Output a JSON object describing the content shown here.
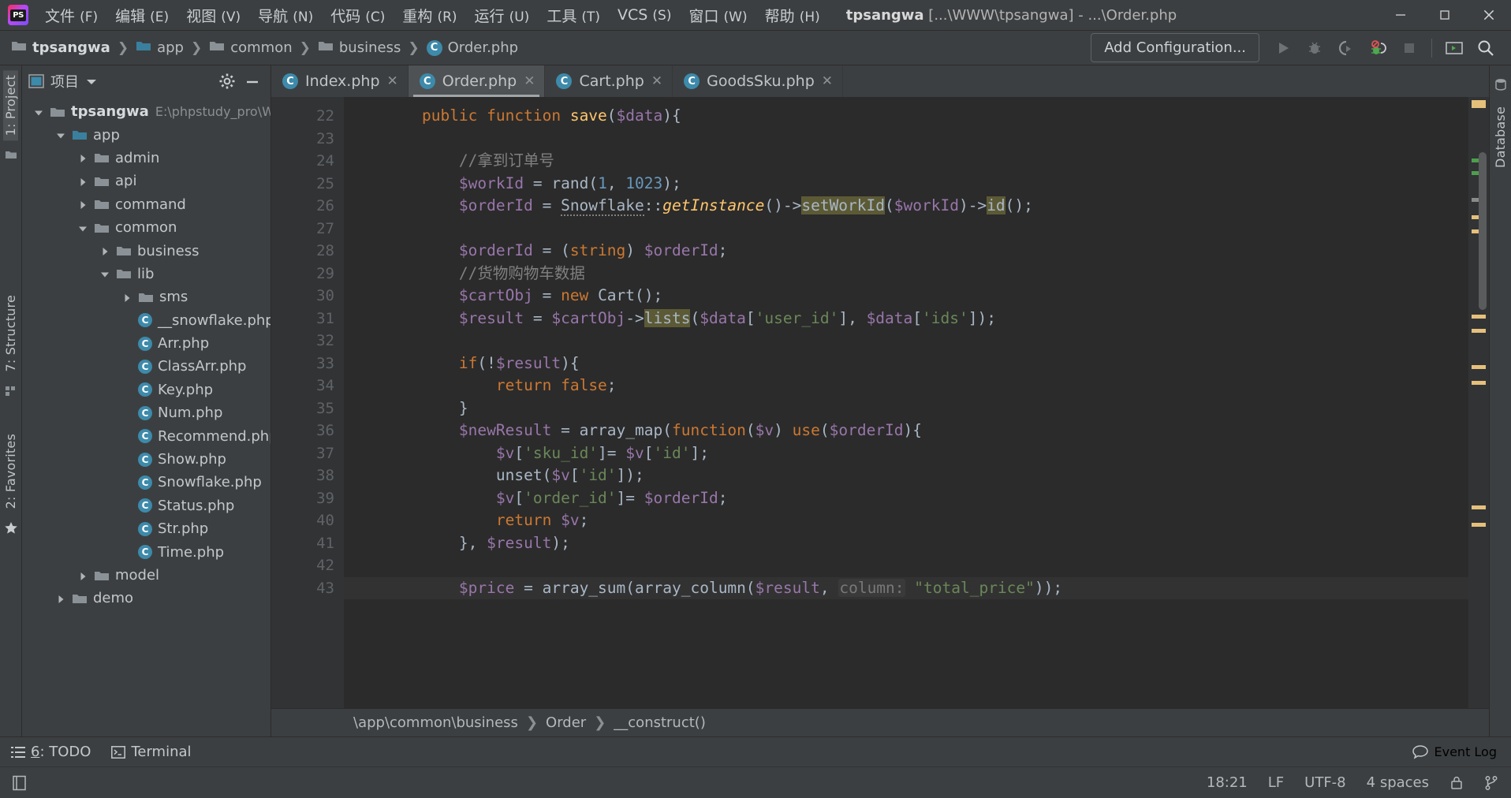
{
  "window": {
    "title_project": "tpsangwa",
    "title_rest": " [...\\WWW\\tpsangwa] - ...\\Order.php",
    "minimize": "minimize-icon",
    "maximize": "maximize-icon",
    "close": "close-icon"
  },
  "menu": [
    {
      "label": "文件",
      "mnemonic": "(F)"
    },
    {
      "label": "编辑",
      "mnemonic": "(E)"
    },
    {
      "label": "视图",
      "mnemonic": "(V)"
    },
    {
      "label": "导航",
      "mnemonic": "(N)"
    },
    {
      "label": "代码",
      "mnemonic": "(C)"
    },
    {
      "label": "重构",
      "mnemonic": "(R)"
    },
    {
      "label": "运行",
      "mnemonic": "(U)"
    },
    {
      "label": "工具",
      "mnemonic": "(T)"
    },
    {
      "label": "VCS",
      "mnemonic": "(S)"
    },
    {
      "label": "窗口",
      "mnemonic": "(W)"
    },
    {
      "label": "帮助",
      "mnemonic": "(H)"
    }
  ],
  "breadcrumb": [
    {
      "label": "tpsangwa",
      "type": "folder",
      "accent": "#8a9297",
      "bold": true
    },
    {
      "label": "app",
      "type": "folder",
      "accent": "#3b7f9e",
      "bold": false
    },
    {
      "label": "common",
      "type": "folder",
      "accent": "#8a9297",
      "bold": false
    },
    {
      "label": "business",
      "type": "folder",
      "accent": "#8a9297",
      "bold": false
    },
    {
      "label": "Order.php",
      "type": "php",
      "accent": "#3d8aab",
      "bold": false
    }
  ],
  "toolbar": {
    "add_configuration": "Add Configuration...",
    "icons": [
      "run-icon",
      "debug-icon",
      "run-with-coverage-icon",
      "stop-debugger-icon",
      "stop-icon",
      "terminal-window-icon",
      "search-everywhere-icon"
    ]
  },
  "left_strips": [
    {
      "label": "1: Project",
      "selected": true
    },
    {
      "label": "7: Structure",
      "selected": false
    },
    {
      "label": "2: Favorites",
      "selected": false
    }
  ],
  "right_strips": [
    {
      "label": "Database"
    }
  ],
  "project_panel": {
    "title": "项目",
    "gear": "gear-icon",
    "collapse": "hide-icon",
    "tree": [
      {
        "depth": 0,
        "label": "tpsangwa",
        "path": "E:\\phpstudy_pro\\W",
        "icon": "folder",
        "state": "expanded",
        "bold": true,
        "accent": "#8a9297"
      },
      {
        "depth": 1,
        "label": "app",
        "path": "",
        "icon": "folder",
        "state": "expanded",
        "bold": false,
        "accent": "#3b7f9e"
      },
      {
        "depth": 2,
        "label": "admin",
        "path": "",
        "icon": "folder",
        "state": "collapsed",
        "bold": false,
        "accent": "#8a9297"
      },
      {
        "depth": 2,
        "label": "api",
        "path": "",
        "icon": "folder",
        "state": "collapsed",
        "bold": false,
        "accent": "#8a9297"
      },
      {
        "depth": 2,
        "label": "command",
        "path": "",
        "icon": "folder",
        "state": "collapsed",
        "bold": false,
        "accent": "#8a9297"
      },
      {
        "depth": 2,
        "label": "common",
        "path": "",
        "icon": "folder",
        "state": "expanded",
        "bold": false,
        "accent": "#8a9297"
      },
      {
        "depth": 3,
        "label": "business",
        "path": "",
        "icon": "folder",
        "state": "collapsed",
        "bold": false,
        "accent": "#8a9297"
      },
      {
        "depth": 3,
        "label": "lib",
        "path": "",
        "icon": "folder",
        "state": "expanded",
        "bold": false,
        "accent": "#8a9297"
      },
      {
        "depth": 4,
        "label": "sms",
        "path": "",
        "icon": "folder",
        "state": "collapsed",
        "bold": false,
        "accent": "#8a9297"
      },
      {
        "depth": 4,
        "label": "__snowflake.php",
        "path": "",
        "icon": "php",
        "state": "leaf",
        "bold": false,
        "accent": "#3d8aab"
      },
      {
        "depth": 4,
        "label": "Arr.php",
        "path": "",
        "icon": "php",
        "state": "leaf",
        "bold": false,
        "accent": "#3d8aab"
      },
      {
        "depth": 4,
        "label": "ClassArr.php",
        "path": "",
        "icon": "php",
        "state": "leaf",
        "bold": false,
        "accent": "#3d8aab"
      },
      {
        "depth": 4,
        "label": "Key.php",
        "path": "",
        "icon": "php",
        "state": "leaf",
        "bold": false,
        "accent": "#3d8aab"
      },
      {
        "depth": 4,
        "label": "Num.php",
        "path": "",
        "icon": "php",
        "state": "leaf",
        "bold": false,
        "accent": "#3d8aab"
      },
      {
        "depth": 4,
        "label": "Recommend.php",
        "path": "",
        "icon": "php",
        "state": "leaf",
        "bold": false,
        "accent": "#3d8aab"
      },
      {
        "depth": 4,
        "label": "Show.php",
        "path": "",
        "icon": "php",
        "state": "leaf",
        "bold": false,
        "accent": "#3d8aab"
      },
      {
        "depth": 4,
        "label": "Snowflake.php",
        "path": "",
        "icon": "php",
        "state": "leaf",
        "bold": false,
        "accent": "#3d8aab"
      },
      {
        "depth": 4,
        "label": "Status.php",
        "path": "",
        "icon": "php",
        "state": "leaf",
        "bold": false,
        "accent": "#3d8aab"
      },
      {
        "depth": 4,
        "label": "Str.php",
        "path": "",
        "icon": "php",
        "state": "leaf",
        "bold": false,
        "accent": "#3d8aab"
      },
      {
        "depth": 4,
        "label": "Time.php",
        "path": "",
        "icon": "php",
        "state": "leaf",
        "bold": false,
        "accent": "#3d8aab"
      },
      {
        "depth": 2,
        "label": "model",
        "path": "",
        "icon": "folder",
        "state": "collapsed",
        "bold": false,
        "accent": "#8a9297"
      },
      {
        "depth": 1,
        "label": "demo",
        "path": "",
        "icon": "folder",
        "state": "collapsed",
        "bold": false,
        "accent": "#8a9297"
      }
    ]
  },
  "editor": {
    "tabs": [
      {
        "label": "Index.php",
        "active": false,
        "close": "close-icon"
      },
      {
        "label": "Order.php",
        "active": true,
        "close": "close-icon"
      },
      {
        "label": "Cart.php",
        "active": false,
        "close": "close-icon"
      },
      {
        "label": "GoodsSku.php",
        "active": false,
        "close": "close-icon"
      }
    ],
    "first_line_number": 22,
    "lines": [
      {
        "n": 22,
        "fold": "collapse",
        "html": "    <span class=\"kw\">public function</span> <span class=\"fn\">save</span>(<span class=\"var\">$data</span>){"
      },
      {
        "n": 23,
        "fold": "",
        "html": ""
      },
      {
        "n": 24,
        "fold": "",
        "html": "        <span class=\"cmt\">//拿到订单号</span>"
      },
      {
        "n": 25,
        "fold": "",
        "html": "        <span class=\"var\">$workId</span> = <span class=\"cls\">rand</span>(<span class=\"num\">1</span>, <span class=\"num\">1023</span>);"
      },
      {
        "n": 26,
        "fold": "",
        "html": "        <span class=\"var\">$orderId</span> = <span class=\"wavy\">Snowflake</span>::<span class=\"fni\">getInstance</span>()-&gt;<span class=\"hl\">setWorkId</span>(<span class=\"var\">$workId</span>)-&gt;<span class=\"hl\">id</span>();"
      },
      {
        "n": 27,
        "fold": "",
        "html": ""
      },
      {
        "n": 28,
        "fold": "",
        "html": "        <span class=\"var\">$orderId</span> = (<span class=\"kw\">string</span>) <span class=\"var\">$orderId</span>;"
      },
      {
        "n": 29,
        "fold": "",
        "html": "        <span class=\"cmt\">//货物购物车数据</span>"
      },
      {
        "n": 30,
        "fold": "",
        "html": "        <span class=\"var\">$cartObj</span> = <span class=\"kw\">new</span> <span class=\"cls\">Cart</span>();"
      },
      {
        "n": 31,
        "fold": "",
        "html": "        <span class=\"var\">$result</span> = <span class=\"var\">$cartObj</span>-&gt;<span class=\"hl\">lists</span>(<span class=\"var\">$data</span>[<span class=\"str\">'user_id'</span>], <span class=\"var\">$data</span>[<span class=\"str\">'ids'</span>]);"
      },
      {
        "n": 32,
        "fold": "",
        "html": ""
      },
      {
        "n": 33,
        "fold": "collapse",
        "html": "        <span class=\"kw\">if</span>(!<span class=\"var\">$result</span>){"
      },
      {
        "n": 34,
        "fold": "",
        "html": "            <span class=\"kw\">return</span> <span class=\"kw\">false</span>;"
      },
      {
        "n": 35,
        "fold": "end",
        "html": "        }"
      },
      {
        "n": 36,
        "fold": "collapse",
        "html": "        <span class=\"var\">$newResult</span> = <span class=\"cls\">array_map</span>(<span class=\"kw\">function</span>(<span class=\"var\">$v</span>) <span class=\"kw\">use</span>(<span class=\"var\">$orderId</span>){"
      },
      {
        "n": 37,
        "fold": "",
        "html": "            <span class=\"var\">$v</span>[<span class=\"str\">'sku_id'</span>]= <span class=\"var\">$v</span>[<span class=\"str\">'id'</span>];"
      },
      {
        "n": 38,
        "fold": "",
        "html": "            <span class=\"cls\">unset</span>(<span class=\"var\">$v</span>[<span class=\"str\">'id'</span>]);"
      },
      {
        "n": 39,
        "fold": "",
        "html": "            <span class=\"var\">$v</span>[<span class=\"str\">'order_id'</span>]= <span class=\"var\">$orderId</span>;"
      },
      {
        "n": 40,
        "fold": "",
        "html": "            <span class=\"kw\">return</span> <span class=\"var\">$v</span>;"
      },
      {
        "n": 41,
        "fold": "end",
        "html": "        }, <span class=\"var\">$result</span>);"
      },
      {
        "n": 42,
        "fold": "",
        "html": ""
      },
      {
        "n": 43,
        "fold": "",
        "html": "        <span class=\"var\">$price</span> = <span class=\"cls\">array_sum</span>(<span class=\"cls\">array_column</span>(<span class=\"var\">$result</span>, <span class=\"hint\">column:</span> <span class=\"str\">\"total_price\"</span>));",
        "current": true
      }
    ],
    "breadcrumb": [
      "\\app\\common\\business",
      "Order",
      "__construct()"
    ]
  },
  "bottom_tools": [
    {
      "label_prefix": "",
      "mnemonic": "6",
      "label": ": TODO",
      "icon": "todo-icon"
    },
    {
      "label_prefix": "",
      "mnemonic": "",
      "label": "Terminal",
      "icon": "terminal-icon"
    }
  ],
  "event_log": {
    "label": "Event Log",
    "icon": "balloon-icon"
  },
  "status": {
    "time": "18:21",
    "line_separator": "LF",
    "encoding": "UTF-8",
    "indent": "4 spaces",
    "lock_icon": "lock-icon",
    "branch_icon": "git-branch-icon"
  }
}
